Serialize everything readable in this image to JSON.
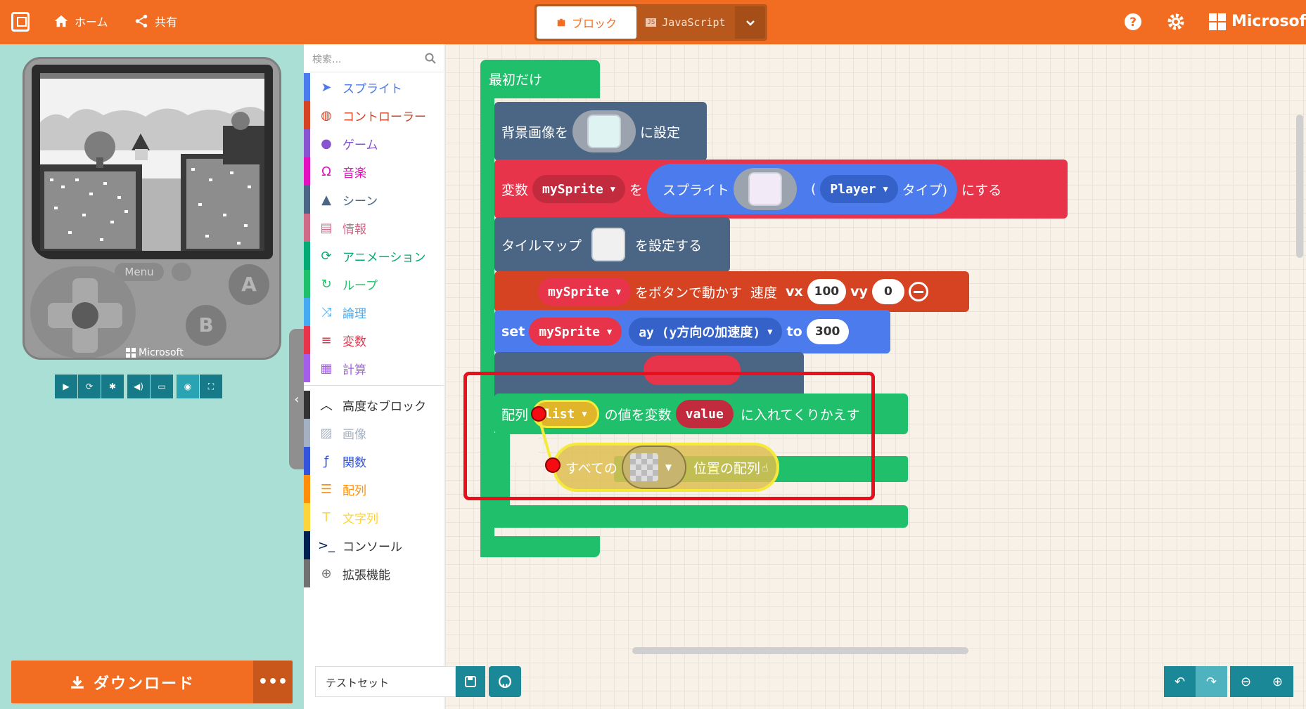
{
  "header": {
    "home_label": "ホーム",
    "share_label": "共有",
    "mode_blocks": "ブロック",
    "mode_js": "JavaScript",
    "brand": "Microsoft"
  },
  "simulator": {
    "menu_label": "Menu",
    "button_a": "A",
    "button_b": "B",
    "brand": "Microsoft"
  },
  "download": {
    "label": "ダウンロード",
    "more": "•••"
  },
  "toolbox": {
    "search_placeholder": "検索...",
    "categories": [
      {
        "label": "スプライト",
        "color": "#4b7bec",
        "icon": "paper-plane-icon"
      },
      {
        "label": "コントローラー",
        "color": "#d54322",
        "icon": "gamepad-icon"
      },
      {
        "label": "ゲーム",
        "color": "#8854d0",
        "icon": "circle-icon"
      },
      {
        "label": "音楽",
        "color": "#e30fc0",
        "icon": "headphones-icon"
      },
      {
        "label": "シーン",
        "color": "#4b6584",
        "icon": "tree-icon"
      },
      {
        "label": "情報",
        "color": "#cf6a87",
        "icon": "id-card-icon"
      },
      {
        "label": "アニメーション",
        "color": "#03aa74",
        "icon": "refresh-icon"
      },
      {
        "label": "ループ",
        "color": "#20bf6b",
        "icon": "loop-icon"
      },
      {
        "label": "論理",
        "color": "#45aaf2",
        "icon": "shuffle-icon"
      },
      {
        "label": "変数",
        "color": "#e8344a",
        "icon": "list-icon"
      },
      {
        "label": "計算",
        "color": "#a55eea",
        "icon": "calculator-icon"
      }
    ],
    "advanced": [
      {
        "label": "高度なブロック",
        "color": "#333333",
        "icon": "chevron-up-icon"
      },
      {
        "label": "画像",
        "color": "#a5b1c2",
        "icon": "image-icon"
      },
      {
        "label": "関数",
        "color": "#3455db",
        "icon": "function-icon"
      },
      {
        "label": "配列",
        "color": "#ff8f08",
        "icon": "array-icon"
      },
      {
        "label": "文字列",
        "color": "#ffd43a",
        "icon": "text-icon"
      },
      {
        "label": "コンソール",
        "color": "#002050",
        "icon": "terminal-icon"
      },
      {
        "label": "拡張機能",
        "color": "#717171",
        "icon": "plus-circle-icon"
      }
    ]
  },
  "blocks": {
    "on_start": "最初だけ",
    "set_bg": "背景画像を",
    "set_bg_suffix": "に設定",
    "var_label": "変数",
    "var_name": "mySprite",
    "to": "を",
    "sprite_label": "スプライト",
    "paren_open": "(",
    "kind": "Player",
    "kind_suffix": "タイプ)",
    "make": "にする",
    "tilemap": "タイルマップ",
    "tilemap_suffix": "を設定する",
    "move_sprite": "mySprite",
    "move_label": "をボタンで動かす",
    "speed": "速度",
    "vx": "vx",
    "vx_val": "100",
    "vy": "vy",
    "vy_val": "0",
    "set": "set",
    "set_sprite": "mySprite",
    "ay": "ay (y方向の加速度)",
    "to_kw": "to",
    "ay_val": "300",
    "foreach_array": "配列",
    "list": "list",
    "foreach_mid": "の値を変数",
    "value": "value",
    "foreach_end": "に入れてくりかえす",
    "all_of": "すべての",
    "positions": "位置の配列"
  },
  "footer": {
    "project_name": "テストセット"
  },
  "colors": {
    "accent": "#f26d21",
    "loops_green": "#20bf6b",
    "sprites_blue": "#4b7bec",
    "variables_red": "#e8344a",
    "controller_red": "#d54322",
    "scene_slate": "#4b6584",
    "arrays_yellow": "#e9bd2f"
  }
}
